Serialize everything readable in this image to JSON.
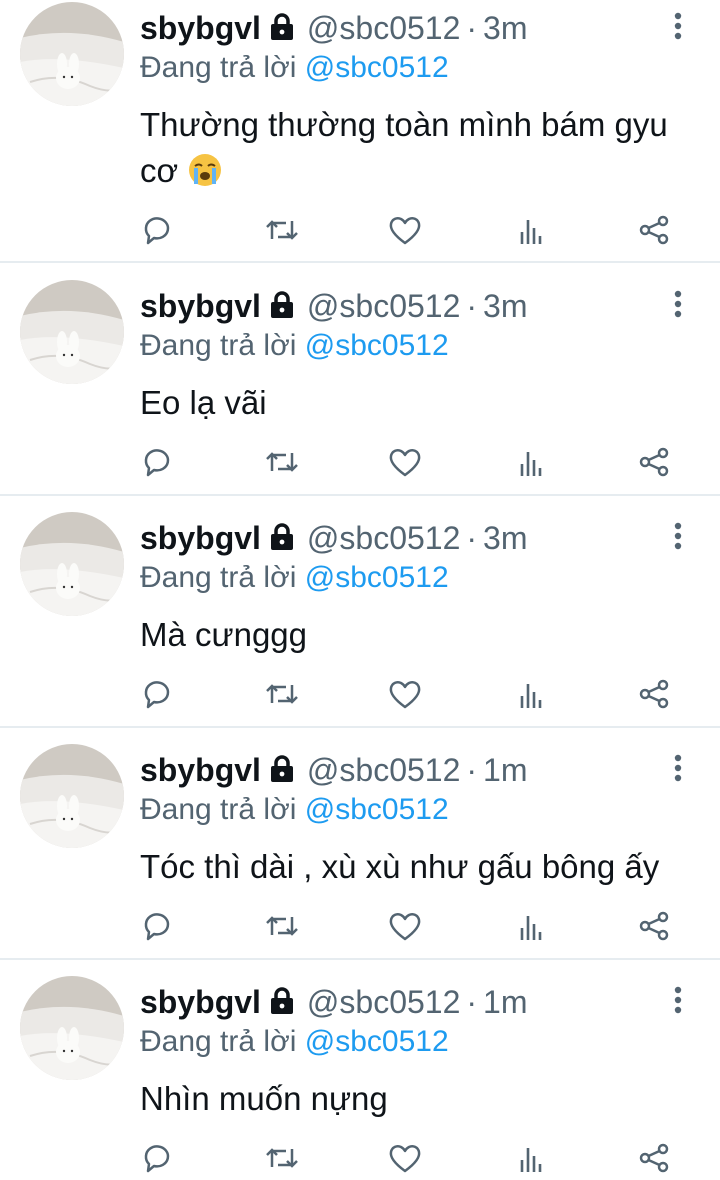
{
  "colors": {
    "accent": "#1d9bf0",
    "secondary_text": "#536471",
    "primary_text": "#0f1419",
    "divider": "#e6ecf0"
  },
  "tweets": [
    {
      "name": "sbybgvl",
      "handle": "@sbc0512",
      "dot": "·",
      "time": "3m",
      "reply_prefix": "Đang trả lời",
      "reply_to": "@sbc0512",
      "text": "Thường thường toàn mình bám gyu cơ",
      "emoji": "loudly-crying-face-emoji"
    },
    {
      "name": "sbybgvl",
      "handle": "@sbc0512",
      "dot": "·",
      "time": "3m",
      "reply_prefix": "Đang trả lời",
      "reply_to": "@sbc0512",
      "text": "Eo lạ vãi"
    },
    {
      "name": "sbybgvl",
      "handle": "@sbc0512",
      "dot": "·",
      "time": "3m",
      "reply_prefix": "Đang trả lời",
      "reply_to": "@sbc0512",
      "text": "Mà cưnggg"
    },
    {
      "name": "sbybgvl",
      "handle": "@sbc0512",
      "dot": "·",
      "time": "1m",
      "reply_prefix": "Đang trả lời",
      "reply_to": "@sbc0512",
      "text": "Tóc thì dài , xù xù như gấu bông ấy"
    },
    {
      "name": "sbybgvl",
      "handle": "@sbc0512",
      "dot": "·",
      "time": "1m",
      "reply_prefix": "Đang trả lời",
      "reply_to": "@sbc0512",
      "text": "Nhìn muốn nựng"
    }
  ],
  "icons": {
    "lock": "lock-icon",
    "more": "more-vertical-icon",
    "reply": "reply-icon",
    "retweet": "retweet-icon",
    "like": "heart-icon",
    "views": "views-icon",
    "share": "share-icon"
  }
}
